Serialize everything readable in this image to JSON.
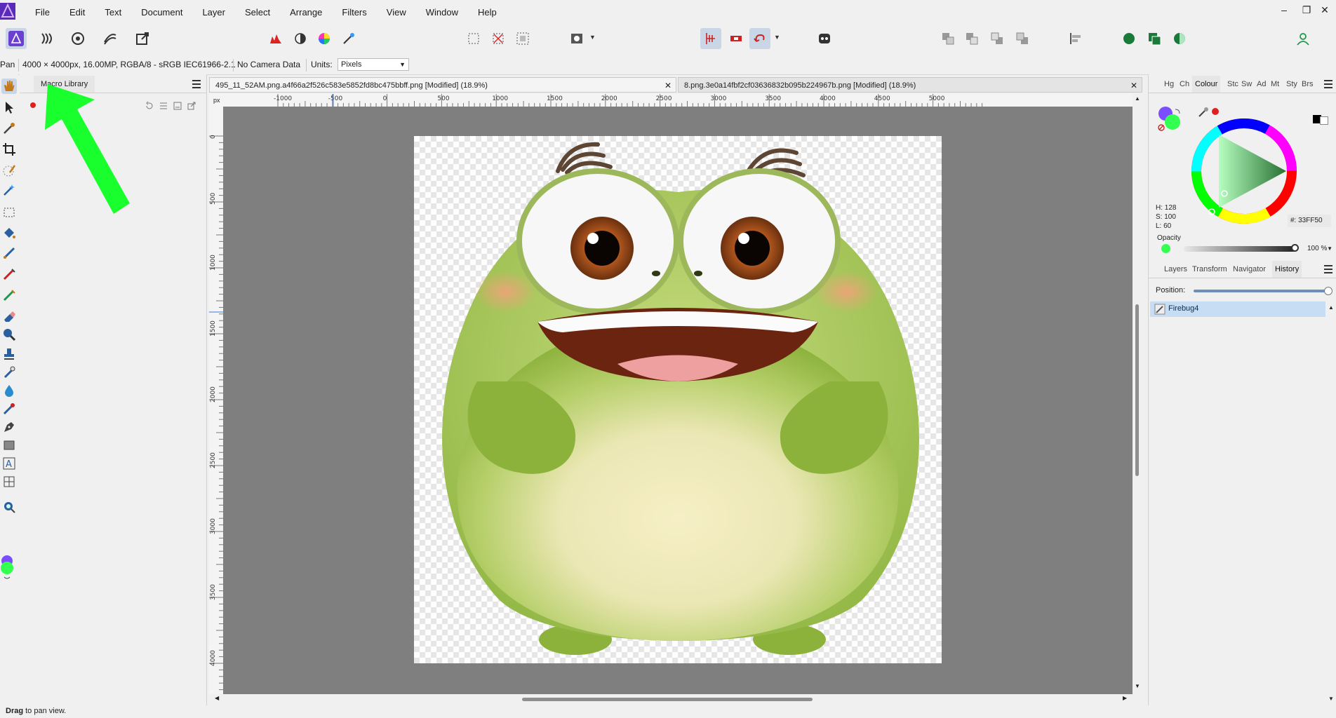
{
  "app": {
    "menus": [
      "File",
      "Edit",
      "Text",
      "Document",
      "Layer",
      "Select",
      "Arrange",
      "Filters",
      "View",
      "Window",
      "Help"
    ]
  },
  "context_bar": {
    "tool": "Pan",
    "doc_info": "4000 × 4000px, 16.00MP, RGBA/8 - sRGB IEC61966-2.1",
    "camera": "No Camera Data",
    "units_label": "Units:",
    "units_value": "Pixels"
  },
  "macro_panel": {
    "tab_label": "Macro Library"
  },
  "document_tabs": [
    {
      "label": "495_11_52AM.png.a4f66a2f526c583e5852fd8bc475bbff.png [Modified] (18.9%)"
    },
    {
      "label": "8.png.3e0a14fbf2cf03636832b095b224967b.png [Modified] (18.9%)"
    }
  ],
  "rulers": {
    "unit": "px",
    "h_ticks": [
      "-1000",
      "-500",
      "0",
      "500",
      "1000",
      "1500",
      "2000",
      "2500",
      "3000",
      "3500",
      "4000",
      "4500",
      "5000"
    ],
    "v_ticks": [
      "0",
      "500",
      "1000",
      "1500",
      "2000",
      "2500",
      "3000",
      "3500",
      "4000"
    ]
  },
  "colour_panel": {
    "tabs": [
      "Hg",
      "Ch",
      "Colour",
      "Stc",
      "Sw",
      "Ad",
      "Mt",
      "Sty",
      "Brs"
    ],
    "active_tab": "Colour",
    "h": "H: 128",
    "s": "S: 100",
    "l": "L: 60",
    "hex_label": "#:",
    "hex_value": "33FF50",
    "opacity_label": "Opacity",
    "opacity_value": "100 %",
    "opacity_level": 1.0,
    "colors": {
      "primary": "#7b4dff",
      "secondary": "#33ff50",
      "accent": "#e02020"
    }
  },
  "history_panel": {
    "tabs": [
      "Layers",
      "Transform",
      "Navigator",
      "History"
    ],
    "active_tab": "History",
    "position_label": "Position:",
    "position_level": 1.0,
    "items": [
      "Firebug4"
    ]
  },
  "status_bar": {
    "bold": "Drag",
    "text": " to pan view."
  },
  "icons": {
    "toolbar": [
      "affinity-photo-logo",
      "liquify-persona-icon",
      "develop-persona-icon",
      "tone-mapping-persona-icon",
      "export-persona-icon",
      "levels-icon",
      "mask-icon",
      "color-wheel-icon",
      "magic-wand-icon",
      "snapping-icon",
      "assistant-icon"
    ]
  }
}
